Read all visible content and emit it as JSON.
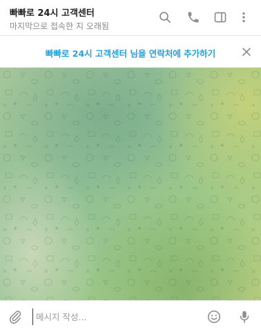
{
  "header": {
    "title": "빠빠로 24시 고객센터",
    "status": "마지막으로 접속한 지 오래됨",
    "icons": [
      "search-icon",
      "phone-icon",
      "sidebar-toggle-icon",
      "more-vertical-icon"
    ]
  },
  "contact_bar": {
    "add_contact_label": "빠빠로 24시 고객센터 님을 연락처에 추가하기",
    "close_icon": "close-icon"
  },
  "composer": {
    "placeholder": "메시지 작성...",
    "value": "",
    "icons": [
      "paperclip-icon",
      "emoji-icon",
      "microphone-icon"
    ]
  },
  "colors": {
    "accent": "#2a9fd8",
    "icon": "#8a8f94",
    "title": "#222222",
    "status": "#8a8a8a",
    "chat_bg": "#9cc592"
  }
}
